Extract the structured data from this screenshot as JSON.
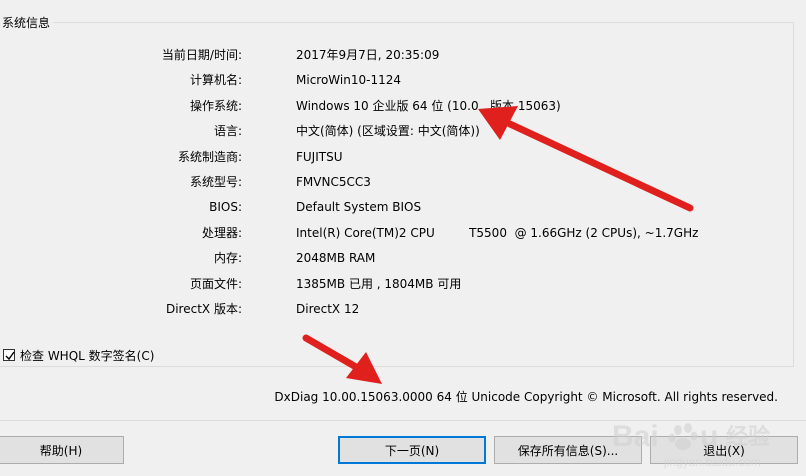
{
  "group": {
    "title": "系统信息"
  },
  "info_rows": [
    {
      "label": "当前日期/时间:",
      "value": "2017年9月7日, 20:35:09"
    },
    {
      "label": "计算机名:",
      "value": "MicroWin10-1124"
    },
    {
      "label": "操作系统:",
      "value": "Windows 10 企业版 64 位 (10.0 , 版本 15063)"
    },
    {
      "label": "语言:",
      "value": "中文(简体) (区域设置: 中文(简体))"
    },
    {
      "label": "系统制造商:",
      "value": "FUJITSU"
    },
    {
      "label": "系统型号:",
      "value": "FMVNC5CC3"
    },
    {
      "label": "BIOS:",
      "value": "Default System BIOS"
    },
    {
      "label": "处理器:",
      "value": "Intel(R) Core(TM)2 CPU         T5500  @ 1.66GHz (2 CPUs), ~1.7GHz"
    },
    {
      "label": "内存:",
      "value": "2048MB RAM"
    },
    {
      "label": "页面文件:",
      "value": "1385MB 已用 , 1804MB 可用"
    },
    {
      "label": "DirectX 版本:",
      "value": "DirectX 12"
    }
  ],
  "whql_checkbox": {
    "label": "检查 WHQL 数字签名(C)",
    "checked": true
  },
  "footer": {
    "text": "DxDiag 10.00.15063.0000 64 位 Unicode  Copyright © Microsoft. All rights reserved."
  },
  "buttons": {
    "help": "帮助(H)",
    "next": "下一页(N)",
    "save": "保存所有信息(S)...",
    "exit": "退出(X)"
  },
  "watermark": {
    "text": "Baidu 经验",
    "subtext": "jingyan.baidu.com"
  },
  "colors": {
    "annotation_arrow": "#e0201c",
    "default_button_border": "#0078d7"
  }
}
